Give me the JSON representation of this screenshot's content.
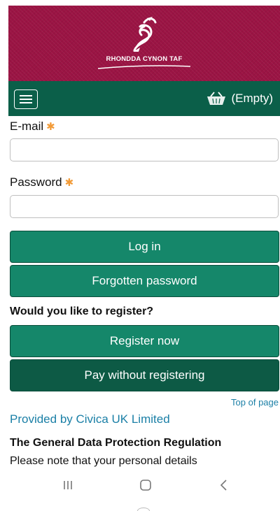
{
  "header": {
    "logo_text": "RHONDDA CYNON TAF",
    "logo_icon": "dragon-logo-icon",
    "menu_icon": "hamburger-menu-icon",
    "basket_icon": "basket-icon",
    "basket_label": "(Empty)"
  },
  "form": {
    "email_label": "E-mail",
    "password_label": "Password",
    "required_marker": "✱",
    "email_value": "",
    "password_value": ""
  },
  "buttons": {
    "login": "Log in",
    "forgotten": "Forgotten password",
    "register": "Register now",
    "pay": "Pay without registering"
  },
  "register_question": "Would you like to register?",
  "footer": {
    "top_link": "Top of page",
    "provided_by": "Provided by Civica UK Limited",
    "gdpr_heading": "The General Data Protection Regulation",
    "gdpr_text": "Please note that your personal details"
  },
  "system_nav": {
    "recents_icon": "recent-apps-icon",
    "home_icon": "home-icon",
    "back_icon": "back-icon"
  },
  "colors": {
    "brand_maroon": "#9b1444",
    "nav_green": "#0b5f49",
    "button_green": "#15876a",
    "button_dark": "#0d5a45",
    "required_orange": "#f29b38",
    "link_blue": "#1a7fa6"
  }
}
